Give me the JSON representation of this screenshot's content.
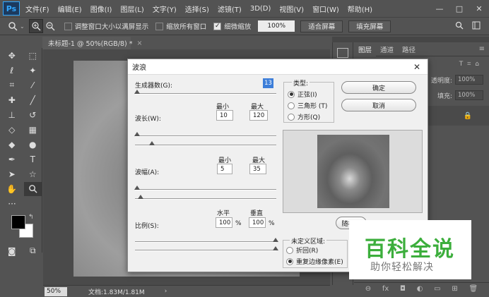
{
  "app": {
    "logo": "Ps"
  },
  "menu": [
    "文件(F)",
    "编辑(E)",
    "图像(I)",
    "图层(L)",
    "文字(Y)",
    "选择(S)",
    "滤镜(T)",
    "3D(D)",
    "视图(V)",
    "窗口(W)",
    "帮助(H)"
  ],
  "window_controls": {
    "minimize": "—",
    "restore": "□",
    "close": "✕"
  },
  "options_bar": {
    "tool_icon": "zoom-icon",
    "check_resize": {
      "label": "调整窗口大小以满屏显示",
      "checked": false
    },
    "check_all_windows": {
      "label": "缩放所有窗口",
      "checked": false
    },
    "check_scrubby": {
      "label": "细微缩放",
      "checked": true
    },
    "zoom_value": "100%",
    "fit_screen": "适合屏幕",
    "fill_screen": "填充屏幕"
  },
  "document": {
    "tab_title": "未标题-1 @ 50%(RGB/8) *",
    "tab_close": "×"
  },
  "status": {
    "zoom": "50%",
    "doc_info": "文档:1.83M/1.81M",
    "arrow": "›"
  },
  "layers_panel": {
    "tabs": [
      "图层",
      "通道",
      "路径"
    ],
    "opacity_label": "透明度:",
    "opacity_value": "100%",
    "fill_label": "填充:",
    "fill_value": "100%"
  },
  "dialog": {
    "title": "波浪",
    "generators_label": "生成器数(G):",
    "generators_value": "13",
    "wavelength_label": "波长(W):",
    "amplitude_label": "波幅(A):",
    "scale_label": "比例(S):",
    "min_label": "最小",
    "max_label": "最大",
    "horiz_label": "水平",
    "vert_label": "垂直",
    "wavelength_min": "10",
    "wavelength_max": "120",
    "amplitude_min": "5",
    "amplitude_max": "35",
    "scale_h": "100",
    "scale_v": "100",
    "percent": "%",
    "type_title": "类型:",
    "types": [
      {
        "label": "正弦(I)",
        "selected": true
      },
      {
        "label": "三角形 (T)",
        "selected": false
      },
      {
        "label": "方形(Q)",
        "selected": false
      }
    ],
    "ok": "确定",
    "cancel": "取消",
    "randomize": "随机化",
    "undefined_title": "未定义区域:",
    "undefined": [
      {
        "label": "折回(R)",
        "selected": false
      },
      {
        "label": "重复边缘像素(E)",
        "selected": true
      }
    ]
  },
  "watermark": {
    "title": "百科全说",
    "subtitle": "助你轻松解决"
  }
}
